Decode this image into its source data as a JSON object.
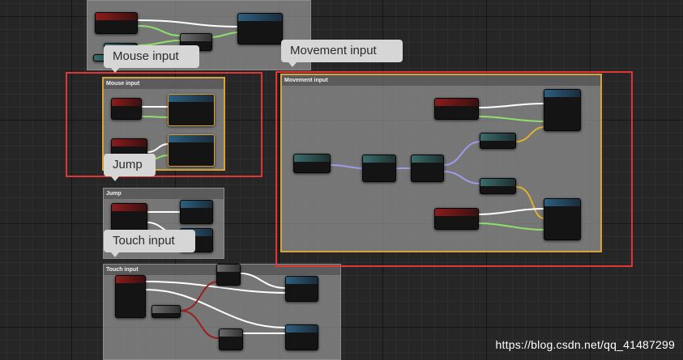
{
  "comments": {
    "mouse_input": {
      "title": "Mouse input"
    },
    "jump": {
      "title": "Jump"
    },
    "touch_input": {
      "title": "Touch input"
    },
    "movement_input": {
      "title": "Movement input"
    }
  },
  "bubbles": {
    "mouse_input": "Mouse input",
    "movement_input": "Movement input",
    "jump": "Jump",
    "touch_input": "Touch input"
  },
  "watermark": "https://blog.csdn.net/qq_41487299",
  "colors": {
    "exec_wire": "#ffffff",
    "float_wire": "#8ee06a",
    "vector_wire": "#9c9ce8",
    "yellow_wire": "#e0b030",
    "red_wire": "#9a1e1e",
    "selection_box": "#e23636"
  }
}
